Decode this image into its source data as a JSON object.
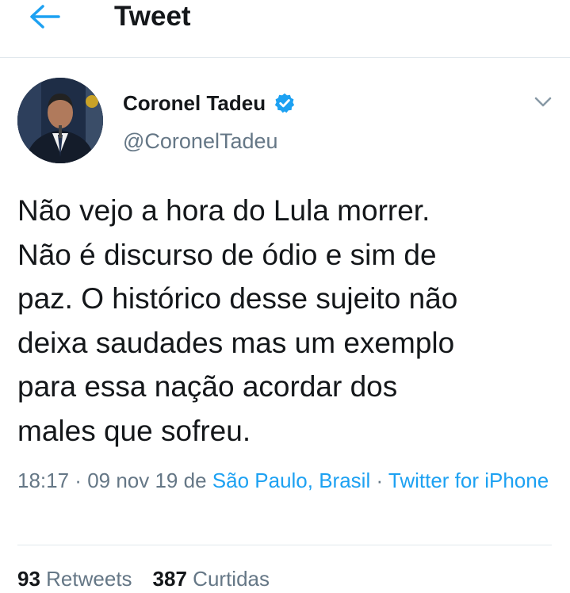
{
  "header": {
    "title": "Tweet",
    "back_icon": "arrow-left-icon"
  },
  "tweet": {
    "author": {
      "display_name": "Coronel Tadeu",
      "handle": "@CoronelTadeu",
      "verified": true
    },
    "text": "Não vejo a hora do Lula morrer.\nNão é discurso de ódio e sim de\npaz. O histórico desse sujeito não\ndeixa saudades mas um exemplo\npara essa nação acordar dos\nmales que sofreu.",
    "time": "18:17",
    "sep1": " · ",
    "date": "09 nov 19",
    "de": " de ",
    "location": "São Paulo, Brasil",
    "sep2": " · ",
    "source": "Twitter for iPhone"
  },
  "stats": {
    "retweets_count": "93",
    "retweets_label": "Retweets",
    "likes_count": "387",
    "likes_label": "Curtidas"
  },
  "colors": {
    "accent": "#1da1f2",
    "secondary_text": "#657786",
    "primary_text": "#14171a",
    "divider": "#e1e8ed"
  }
}
